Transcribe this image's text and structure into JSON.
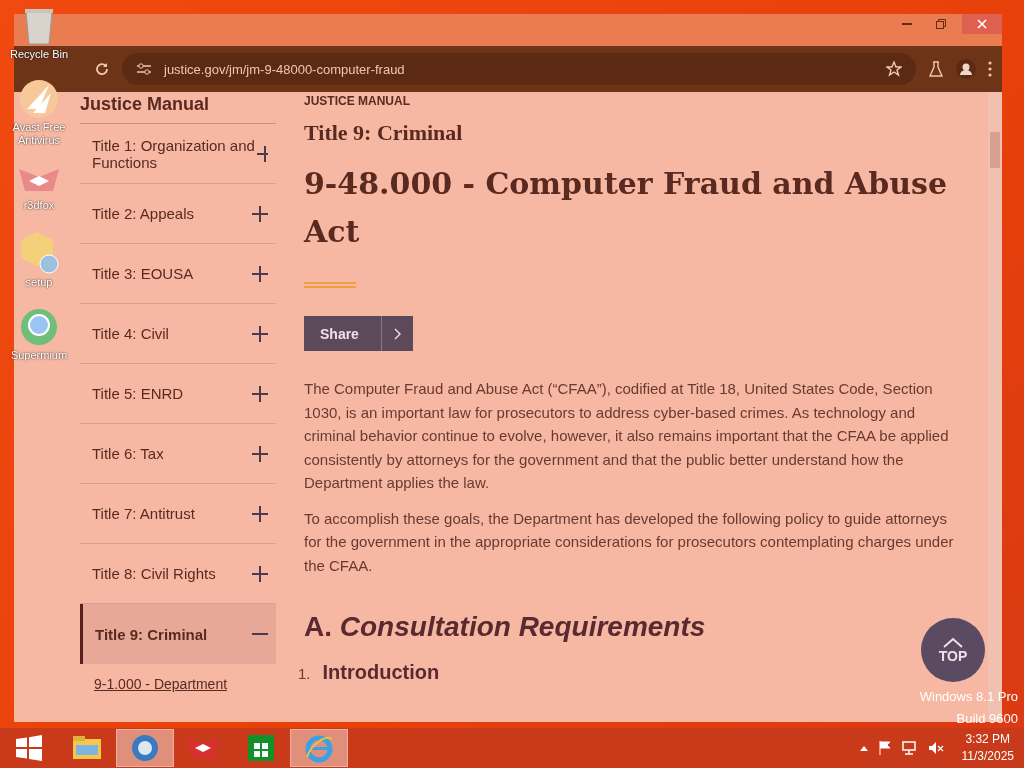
{
  "desktop": {
    "icons": [
      {
        "label": "Recycle Bin",
        "kind": "bin"
      },
      {
        "label": "Avast Free Antivirus",
        "kind": "avast"
      },
      {
        "label": "r3dfox",
        "kind": "fox"
      },
      {
        "label": "setup",
        "kind": "setup"
      },
      {
        "label": "Supermium",
        "kind": "globe"
      }
    ],
    "edition": "Windows 8.1 Pro",
    "build": "Build 9600"
  },
  "browser": {
    "url": "justice.gov/jm/jm-9-48000-computer-fraud"
  },
  "sidebar": {
    "heading": "Justice Manual",
    "items": [
      {
        "label": "Title 1: Organization and Functions",
        "expanded": false
      },
      {
        "label": "Title 2: Appeals",
        "expanded": false
      },
      {
        "label": "Title 3: EOUSA",
        "expanded": false
      },
      {
        "label": "Title 4: Civil",
        "expanded": false
      },
      {
        "label": "Title 5: ENRD",
        "expanded": false
      },
      {
        "label": "Title 6: Tax",
        "expanded": false
      },
      {
        "label": "Title 7: Antitrust",
        "expanded": false
      },
      {
        "label": "Title 8: Civil Rights",
        "expanded": false
      },
      {
        "label": "Title 9: Criminal",
        "expanded": true,
        "children": [
          {
            "label": "9-1.000 - Department"
          }
        ]
      }
    ]
  },
  "main": {
    "eyebrow": "JUSTICE MANUAL",
    "subtitle": "Title 9: Criminal",
    "title": "9-48.000 - Computer Fraud and Abuse Act",
    "share": "Share",
    "paragraphs": [
      "The Computer Fraud and Abuse Act (“CFAA”), codified at Title 18, United States Code, Section 1030, is an important law for prosecutors to address cyber-based crimes. As technology and criminal behavior continue to evolve, however, it also remains important that the CFAA be applied consistently by attorneys for the government and that the public better understand how the Department applies the law.",
      "To accomplish these goals, the Department has developed the following policy to guide attorneys for the government in the appropriate considerations for prosecutors contemplating charges under the CFAA."
    ],
    "section": "A. *Consultation Requirements*",
    "list": [
      {
        "number": "1.",
        "label": "Introduction"
      }
    ],
    "top": "TOP"
  },
  "taskbar": {
    "items": [
      {
        "kind": "explorer",
        "active": false
      },
      {
        "kind": "globe",
        "active": true
      },
      {
        "kind": "fox",
        "active": false
      },
      {
        "kind": "store",
        "active": false
      },
      {
        "kind": "ie",
        "active": true
      }
    ],
    "time": "3:32 PM",
    "date": "11/3/2025"
  }
}
